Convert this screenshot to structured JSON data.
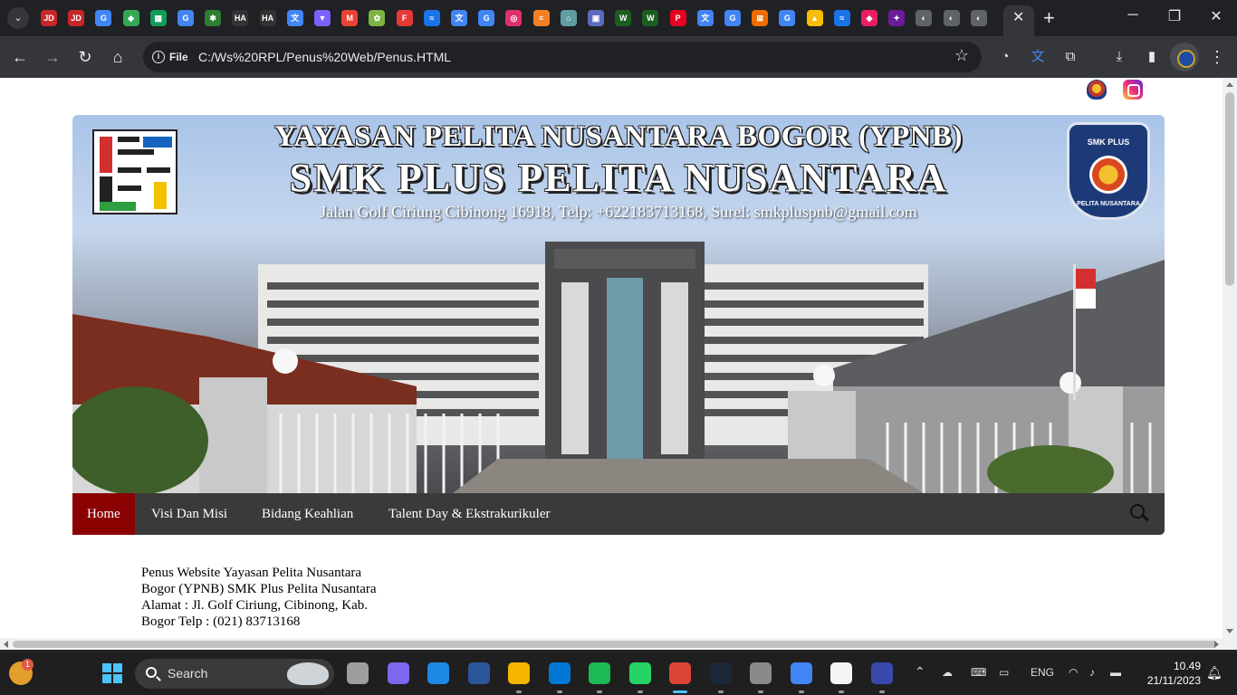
{
  "browser": {
    "tabs": [
      {
        "icon": "jd-icon",
        "color": "#c62828",
        "glyph": "JD"
      },
      {
        "icon": "jd-icon",
        "color": "#c62828",
        "glyph": "JD"
      },
      {
        "icon": "google-icon",
        "color": "#4285f4",
        "glyph": "G"
      },
      {
        "icon": "maps-icon",
        "color": "#34a853",
        "glyph": "◆"
      },
      {
        "icon": "sheets-icon",
        "color": "#0f9d58",
        "glyph": "▦"
      },
      {
        "icon": "google-icon",
        "color": "#4285f4",
        "glyph": "G"
      },
      {
        "icon": "circle-icon",
        "color": "#2e7d32",
        "glyph": "✱"
      },
      {
        "icon": "ha-icon",
        "color": "#333333",
        "glyph": "HA"
      },
      {
        "icon": "ha-icon",
        "color": "#333333",
        "glyph": "HA"
      },
      {
        "icon": "translate-icon",
        "color": "#4285f4",
        "glyph": "文"
      },
      {
        "icon": "triangle-icon",
        "color": "#7b61ff",
        "glyph": "▼"
      },
      {
        "icon": "gmail-icon",
        "color": "#ea4335",
        "glyph": "M"
      },
      {
        "icon": "circle-icon",
        "color": "#7cb342",
        "glyph": "✿"
      },
      {
        "icon": "f-icon",
        "color": "#e53935",
        "glyph": "F"
      },
      {
        "icon": "chart-icon",
        "color": "#1a73e8",
        "glyph": "≈"
      },
      {
        "icon": "translate-icon",
        "color": "#4285f4",
        "glyph": "文"
      },
      {
        "icon": "google-icon",
        "color": "#4285f4",
        "glyph": "G"
      },
      {
        "icon": "instagram-icon",
        "color": "#e1306c",
        "glyph": "◎"
      },
      {
        "icon": "stack-icon",
        "color": "#f48024",
        "glyph": "≡"
      },
      {
        "icon": "home-icon",
        "color": "#5f9ea0",
        "glyph": "⌂"
      },
      {
        "icon": "meet-icon",
        "color": "#5c6bc0",
        "glyph": "▣"
      },
      {
        "icon": "w-icon",
        "color": "#1b5e20",
        "glyph": "W"
      },
      {
        "icon": "w-icon",
        "color": "#1b5e20",
        "glyph": "W"
      },
      {
        "icon": "pinterest-icon",
        "color": "#e60023",
        "glyph": "P"
      },
      {
        "icon": "translate-icon",
        "color": "#4285f4",
        "glyph": "文"
      },
      {
        "icon": "google-icon",
        "color": "#4285f4",
        "glyph": "G"
      },
      {
        "icon": "box-icon",
        "color": "#ef6c00",
        "glyph": "⊠"
      },
      {
        "icon": "google-icon",
        "color": "#4285f4",
        "glyph": "G"
      },
      {
        "icon": "drive-icon",
        "color": "#fbbc04",
        "glyph": "▲"
      },
      {
        "icon": "chart-icon",
        "color": "#1a73e8",
        "glyph": "≈"
      },
      {
        "icon": "cube-icon",
        "color": "#e91e63",
        "glyph": "◆"
      },
      {
        "icon": "emblem-icon",
        "color": "#6a1b9a",
        "glyph": "✦"
      },
      {
        "icon": "globe-icon",
        "color": "#5f6368",
        "glyph": "◐"
      },
      {
        "icon": "globe-icon",
        "color": "#5f6368",
        "glyph": "◐"
      },
      {
        "icon": "globe-icon",
        "color": "#5f6368",
        "glyph": "◐"
      }
    ],
    "active_tab_close": "✕",
    "new_tab": "+",
    "window": {
      "minimize": "─",
      "maximize": "❐",
      "close": "✕"
    },
    "nav": {
      "back": "←",
      "forward": "→",
      "reload": "↻",
      "home": "⌂"
    },
    "site_info_label": "File",
    "url": "C:/Ws%20RPL/Penus%20Web/Penus.HTML",
    "bookmark_star": "☆",
    "menu_dots": "⋮"
  },
  "page": {
    "banner": {
      "title_foundation": "YAYASAN PELITA NUSANTARA BOGOR (YPNB)",
      "title_school": "SMK PLUS PELITA NUSANTARA",
      "address": "Jalan Golf Ciriung Cibinong 16918, Telp: +622183713168, Surel: smkpluspnb@gmail.com",
      "badge_top": "SMK PLUS",
      "badge_bottom": "PELITA NUSANTARA"
    },
    "nav": [
      {
        "label": "Home",
        "active": true
      },
      {
        "label": "Visi Dan Misi",
        "active": false
      },
      {
        "label": "Bidang Keahlian",
        "active": false
      },
      {
        "label": "Talent Day & Ekstrakurikuler",
        "active": false
      }
    ],
    "footer_lines": [
      "Penus Website Yayasan Pelita Nusantara",
      "Bogor (YPNB) SMK Plus Pelita Nusantara",
      "Alamat : Jl. Golf Ciriung, Cibinong, Kab.",
      "Bogor Telp : (021) 83713168"
    ]
  },
  "taskbar": {
    "weather_badge": "1",
    "search_label": "Search",
    "apps": [
      {
        "name": "task-view-icon",
        "color": "#9e9e9e"
      },
      {
        "name": "meet-now-icon",
        "color": "#7b68ee"
      },
      {
        "name": "edge-icon",
        "color": "#1e88e5"
      },
      {
        "name": "word-icon",
        "color": "#2b579a"
      },
      {
        "name": "file-explorer-icon",
        "color": "#f4b400"
      },
      {
        "name": "vscode-icon",
        "color": "#0078d4"
      },
      {
        "name": "spotify-icon",
        "color": "#1db954"
      },
      {
        "name": "whatsapp-icon",
        "color": "#25d366"
      },
      {
        "name": "chrome-icon",
        "color": "#db4437"
      },
      {
        "name": "steam-icon",
        "color": "#1b2838"
      },
      {
        "name": "settings-icon",
        "color": "#8a8a8a"
      },
      {
        "name": "chrome-alt-icon",
        "color": "#4285f4"
      },
      {
        "name": "notepad-icon",
        "color": "#f5f5f5"
      },
      {
        "name": "emblem-app-icon",
        "color": "#3949ab"
      }
    ],
    "tray_lang": "ENG",
    "time": "10.49",
    "date": "21/11/2023"
  }
}
